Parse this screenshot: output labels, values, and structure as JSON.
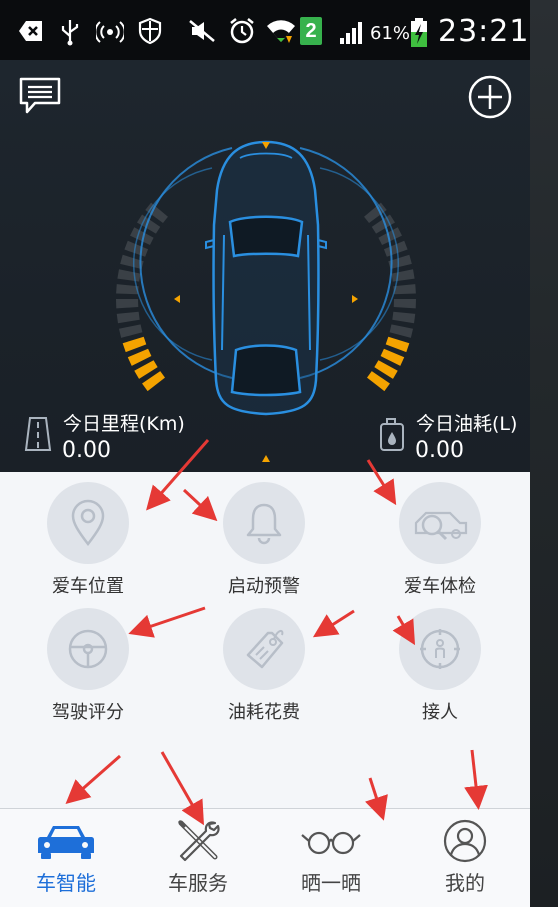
{
  "status_bar": {
    "time": "23:21",
    "battery": "61%",
    "sim_badge": "2",
    "icons": [
      "back-icon",
      "usb-icon",
      "hotspot-icon",
      "shield-icon",
      "mute-icon",
      "alarm-icon",
      "wifi-icon",
      "sim-icon",
      "signal-icon",
      "battery-charging-icon"
    ]
  },
  "dashboard": {
    "mileage_label": "今日里程(Km)",
    "mileage_value": "0.00",
    "fuel_label": "今日油耗(L)",
    "fuel_value": "0.00",
    "accent_color": "#f4a300",
    "car_line_color": "#2a8fe0"
  },
  "functions": [
    {
      "label": "爱车位置",
      "icon": "location-pin-icon"
    },
    {
      "label": "启动预警",
      "icon": "bell-icon"
    },
    {
      "label": "爱车体检",
      "icon": "car-search-icon"
    },
    {
      "label": "驾驶评分",
      "icon": "steering-wheel-icon"
    },
    {
      "label": "油耗花费",
      "icon": "price-tag-icon"
    },
    {
      "label": "接人",
      "icon": "compass-person-icon"
    }
  ],
  "tabs": [
    {
      "label": "车智能",
      "icon": "car-icon",
      "active": true
    },
    {
      "label": "车服务",
      "icon": "tools-icon",
      "active": false
    },
    {
      "label": "晒一晒",
      "icon": "glasses-icon",
      "active": false
    },
    {
      "label": "我的",
      "icon": "user-icon",
      "active": false
    }
  ],
  "colors": {
    "active_tab": "#1e6fd9",
    "annotation_arrow": "#e53935"
  }
}
